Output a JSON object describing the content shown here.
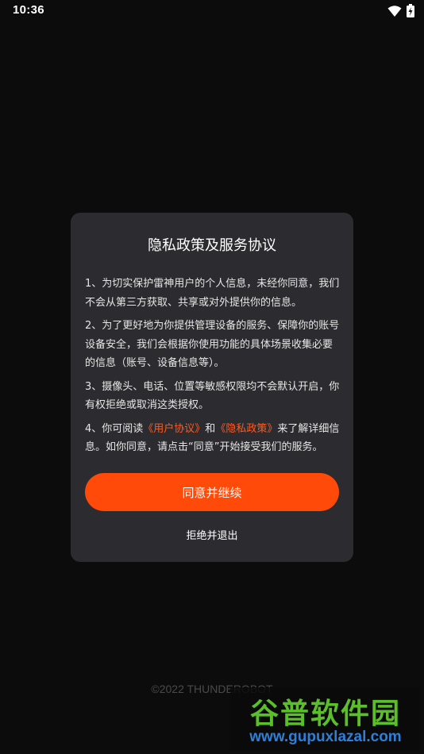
{
  "status_bar": {
    "time": "10:36",
    "icons": [
      "wifi-icon",
      "battery-charging-icon"
    ]
  },
  "dialog": {
    "title": "隐私政策及服务协议",
    "paragraphs": {
      "p1": "1、为切实保护雷神用户的个人信息，未经你同意，我们不会从第三方获取、共享或对外提供你的信息。",
      "p2": "2、为了更好地为你提供管理设备的服务、保障你的账号设备安全，我们会根据你使用功能的具体场景收集必要的信息（账号、设备信息等）。",
      "p3": "3、摄像头、电话、位置等敏感权限均不会默认开启，你有权拒绝或取消这类授权。",
      "p4_prefix": "4、你可阅读",
      "p4_link1": "《用户协议》",
      "p4_mid": "和",
      "p4_link2": "《隐私政策》",
      "p4_suffix": "来了解详细信息。如你同意，请点击“同意”开始接受我们的服务。"
    },
    "agree_label": "同意并继续",
    "reject_label": "拒绝并退出"
  },
  "footer": {
    "copyright": "©2022 THUNDEROBOT"
  },
  "watermark": {
    "title": "谷普软件园",
    "url": "www.gupuxlazal.com"
  },
  "colors": {
    "accent": "#ff4a0a",
    "link": "#ff5a1f",
    "dialog_bg": "#2c2c30",
    "background": "#0c0c0c"
  }
}
